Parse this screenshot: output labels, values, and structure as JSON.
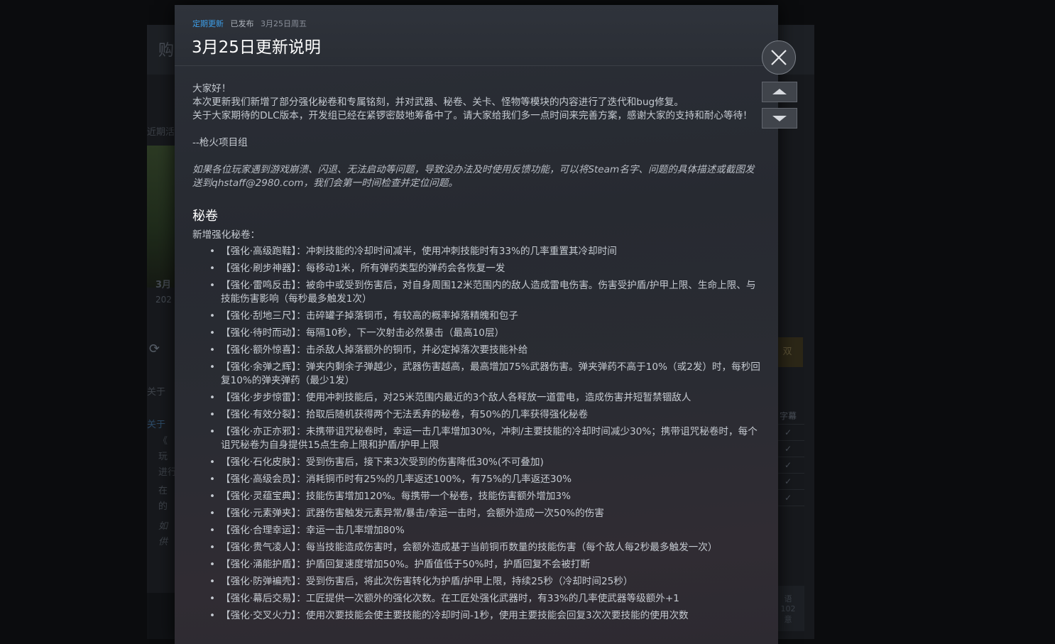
{
  "background": {
    "header_title": "购",
    "section_recent": "近期活",
    "date_fragment": "3月",
    "year_fragment": "202",
    "section_about": "关于",
    "link_fragment": "关于",
    "bullets": [
      {
        "lines": [
          "《",
          "玩",
          "进行"
        ]
      },
      {
        "lines": [
          "在",
          "的"
        ]
      },
      {
        "lines": [
          "如",
          "供"
        ]
      }
    ],
    "right_button_fragment": "双",
    "table_header_fragment": "字幕",
    "table_checks": [
      "✓",
      "✓",
      "✓",
      "✓",
      "✓"
    ],
    "card_lines": [
      "语",
      "102",
      "意"
    ]
  },
  "modal": {
    "category": "定期更新",
    "published_label": "已发布",
    "date": "3月25日周五",
    "title": "3月25日更新说明",
    "intro": [
      "大家好！",
      "本次更新我们新增了部分强化秘卷和专属铭刻，并对武器、秘卷、关卡、怪物等模块的内容进行了迭代和bug修复。",
      "关于大家期待的DLC版本，开发组已经在紧锣密鼓地筹备中了。请大家给我们多一点时间来完善方案，感谢大家的支持和耐心等待！"
    ],
    "signature": "--枪火项目组",
    "feedback_note": "如果各位玩家遇到游戏崩溃、闪退、无法启动等问题，导致没办法及时使用反馈功能，可以将Steam名字、问题的具体描述或截图发送到qhstaff@2980.com，我们会第一时间检查并定位问题。",
    "section_title": "秘卷",
    "section_subtitle": "新增强化秘卷：",
    "scrolls": [
      "【强化·高级跑鞋】：冲刺技能的冷却时间减半，使用冲刺技能时有33%的几率重置其冷却时间",
      "【强化·刷步神器】：每移动1米，所有弹药类型的弹药会各恢复一发",
      "【强化·雷鸣反击】：被命中或受到伤害后，对自身周围12米范围内的敌人造成雷电伤害。伤害受护盾/护甲上限、生命上限、与技能伤害影响（每秒最多触发1次）",
      "【强化·刮地三尺】：击碎罐子掉落铜币，有较高的概率掉落精魄和包子",
      "【强化·待时而动】：每隔10秒，下一次射击必然暴击（最高10层）",
      "【强化·额外惊喜】：击杀敌人掉落额外的铜币，并必定掉落次要技能补给",
      "【强化·余弹之辉】：弹夹内剩余子弹越少，武器伤害越高，最高增加75%武器伤害。弹夹弹药不高于10%（或2发）时，每秒回复10%的弹夹弹药（最少1发）",
      "【强化·步步惊雷】：使用冲刺技能后，对25米范围内最近的3个敌人各释放一道雷电，造成伤害并短暂禁锢敌人",
      "【强化·有效分裂】：拾取后随机获得两个无法丢弃的秘卷，有50%的几率获得强化秘卷",
      "【强化·亦正亦邪】：未携带诅咒秘卷时，幸运一击几率增加30%，冲刺/主要技能的冷却时间减少30%；携带诅咒秘卷时，每个诅咒秘卷为自身提供15点生命上限和护盾/护甲上限",
      "【强化·石化皮肤】：受到伤害后，接下来3次受到的伤害降低30%(不可叠加)",
      "【强化·高级会员】：消耗铜币时有25%的几率返还100%，有75%的几率返还30%",
      "【强化·灵蕴宝典】：技能伤害增加120%。每携带一个秘卷，技能伤害额外增加3%",
      "【强化·元素弹夹】：武器伤害触发元素异常/暴击/幸运一击时，会额外造成一次50%的伤害",
      "【强化·合理幸运】：幸运一击几率增加80%",
      "【强化·贵气凌人】：每当技能造成伤害时，会额外造成基于当前铜币数量的技能伤害（每个敌人每2秒最多触发一次）",
      "【强化·涌能护盾】：护盾回复速度增加50%。护盾值低于50%时，护盾回复不会被打断",
      "【强化·防弹褊壳】：受到伤害后，将此次伤害转化为护盾/护甲上限，持续25秒（冷却时间25秒）",
      "【强化·幕后交易】：工匠提供一次额外的强化次数。在工匠处强化武器时，有33%的几率使武器等级额外+1",
      "【强化·交叉火力】：使用次要技能会使主要技能的冷却时间-1秒，使用主要技能会回复3次次要技能的使用次数"
    ]
  },
  "controls": {
    "close_icon": "close-icon",
    "prev_icon": "chevron-up-icon",
    "next_icon": "chevron-down-icon"
  }
}
